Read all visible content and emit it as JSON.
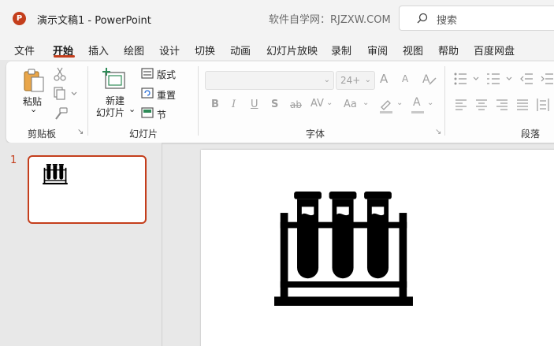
{
  "app": {
    "logo_letter": "P",
    "title": "演示文稿1  -  PowerPoint",
    "watermark": "软件自学网：RJZXW.COM",
    "search_placeholder": "搜索",
    "accent_color": "#c43e1c"
  },
  "tabs": [
    {
      "label": "文件"
    },
    {
      "label": "开始",
      "active": true
    },
    {
      "label": "插入"
    },
    {
      "label": "绘图"
    },
    {
      "label": "设计"
    },
    {
      "label": "切换"
    },
    {
      "label": "动画"
    },
    {
      "label": "幻灯片放映"
    },
    {
      "label": "录制"
    },
    {
      "label": "审阅"
    },
    {
      "label": "视图"
    },
    {
      "label": "帮助"
    },
    {
      "label": "百度网盘"
    }
  ],
  "ribbon": {
    "clipboard": {
      "paste_label": "粘贴",
      "paste_dropdown": "⌄",
      "group_label": "剪贴板",
      "launcher": "↘"
    },
    "slides": {
      "new_slide_line1": "新建",
      "new_slide_line2": "幻灯片",
      "new_slide_dropdown": "⌄",
      "layout_label": "版式",
      "reset_label": "重置",
      "section_label": "节",
      "group_label": "幻灯片"
    },
    "font": {
      "font_name_value": "",
      "font_size_value": "24+",
      "bold": "B",
      "italic": "I",
      "underline": "U",
      "shadow": "S",
      "strikethrough": "ab",
      "spacing": "AV",
      "change_case": "Aa",
      "grow": "A",
      "shrink": "A",
      "font_color": "A",
      "group_label": "字体",
      "launcher": "↘"
    },
    "paragraph": {
      "group_label": "段落"
    }
  },
  "slides_pane": {
    "slide_number": "1"
  }
}
